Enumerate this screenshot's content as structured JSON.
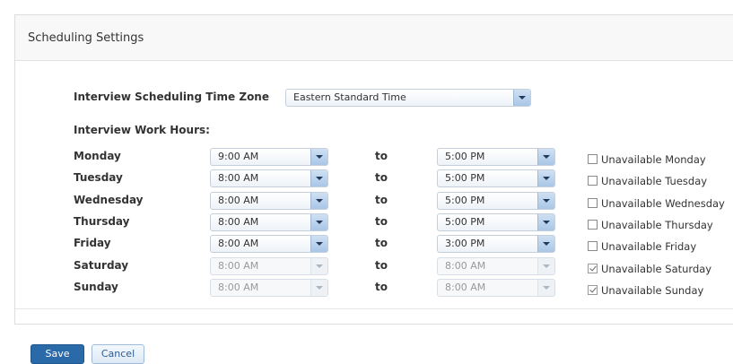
{
  "panel": {
    "title": "Scheduling Settings"
  },
  "timezone": {
    "label": "Interview Scheduling Time Zone",
    "value": "Eastern Standard Time"
  },
  "work_hours": {
    "label": "Interview Work Hours:",
    "to_label": "to",
    "days": [
      {
        "day": "Monday",
        "start": "9:00 AM",
        "end": "5:00 PM",
        "unavailable_label": "Unavailable Monday",
        "unavailable": false
      },
      {
        "day": "Tuesday",
        "start": "8:00 AM",
        "end": "5:00 PM",
        "unavailable_label": "Unavailable Tuesday",
        "unavailable": false
      },
      {
        "day": "Wednesday",
        "start": "8:00 AM",
        "end": "5:00 PM",
        "unavailable_label": "Unavailable Wednesday",
        "unavailable": false
      },
      {
        "day": "Thursday",
        "start": "8:00 AM",
        "end": "5:00 PM",
        "unavailable_label": "Unavailable Thursday",
        "unavailable": false
      },
      {
        "day": "Friday",
        "start": "8:00 AM",
        "end": "3:00 PM",
        "unavailable_label": "Unavailable Friday",
        "unavailable": false
      },
      {
        "day": "Saturday",
        "start": "8:00 AM",
        "end": "8:00 AM",
        "unavailable_label": "Unavailable Saturday",
        "unavailable": true
      },
      {
        "day": "Sunday",
        "start": "8:00 AM",
        "end": "8:00 AM",
        "unavailable_label": "Unavailable Sunday",
        "unavailable": true
      }
    ]
  },
  "actions": {
    "save_label": "Save",
    "cancel_label": "Cancel"
  },
  "colors": {
    "primary": "#2b6aa8",
    "select_button": "#a9c6e6",
    "panel_header": "#f8f8f8"
  }
}
